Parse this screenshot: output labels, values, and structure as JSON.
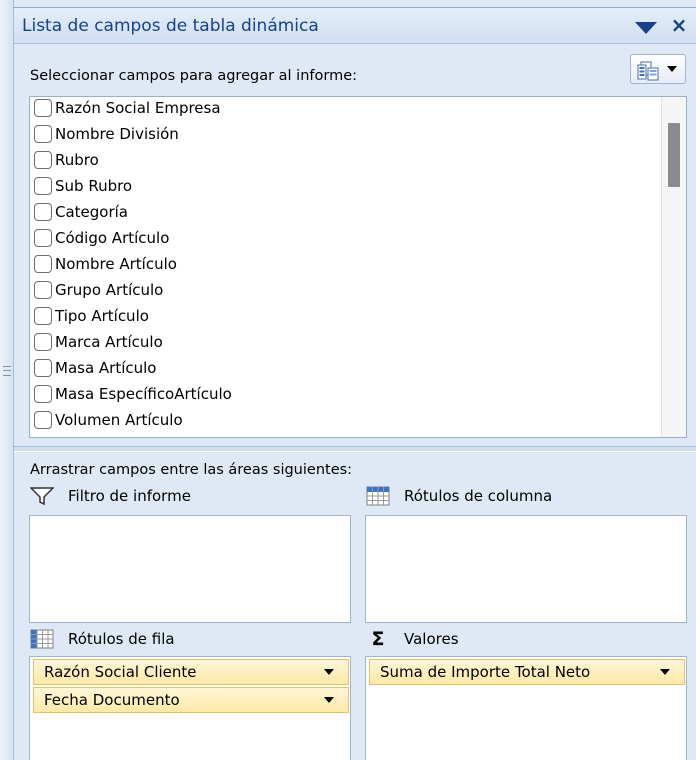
{
  "pane": {
    "title": "Lista de campos de tabla dinámica",
    "close_glyph": "×"
  },
  "top": {
    "select_label": "Seleccionar campos para agregar al informe:",
    "fields": [
      "Razón Social Empresa",
      "Nombre División",
      "Rubro",
      "Sub Rubro",
      "Categoría",
      "Código Artículo",
      "Nombre Artículo",
      "Grupo Artículo",
      "Tipo Artículo",
      "Marca Artículo",
      "Masa Artículo",
      "Masa EspecíficoArtículo",
      "Volumen Artículo"
    ]
  },
  "bottom": {
    "drag_label": "Arrastrar campos entre las áreas siguientes:",
    "filter_label": "Filtro de informe",
    "columns_label": "Rótulos de columna",
    "rows_label": "Rótulos de fila",
    "values_label": "Valores",
    "rows_items": [
      "Razón Social Cliente",
      "Fecha Documento"
    ],
    "values_items": [
      "Suma de Importe Total Neto"
    ],
    "sigma_glyph": "Σ"
  },
  "colors": {
    "title_text": "#15428b",
    "pane_bg": "#dfe9f5",
    "pill_bg": "#ffe9a8",
    "pill_border": "#e5c365"
  },
  "icons": {
    "pane_menu": "dropdown-triangle-icon",
    "close": "close-icon",
    "layout": "field-list-layout-icon",
    "filter": "filter-funnel-icon",
    "columns": "column-grid-icon",
    "rows": "row-grid-icon",
    "values": "sigma-icon"
  }
}
